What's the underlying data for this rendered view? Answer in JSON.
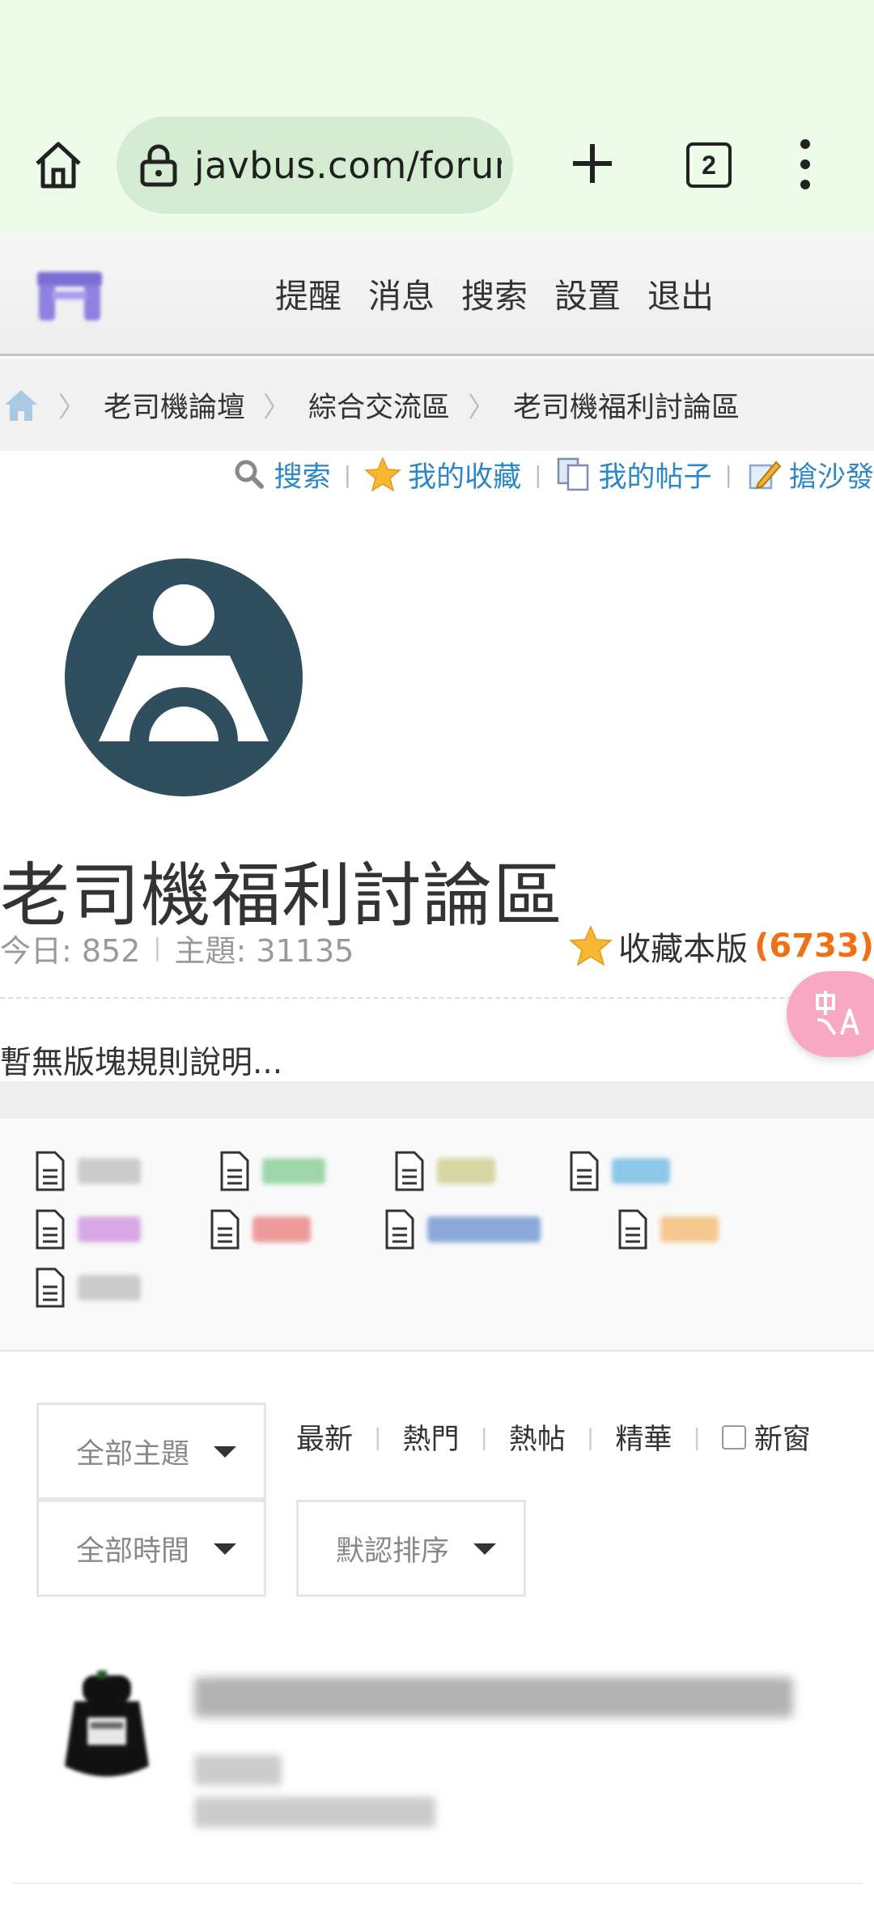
{
  "browser": {
    "url": "javbus.com/forum",
    "tab_count": "2",
    "icons": [
      "home-icon",
      "lock-icon",
      "new-tab-icon",
      "tabs-icon",
      "more-icon"
    ]
  },
  "header": {
    "nav": [
      "提醒",
      "消息",
      "搜索",
      "設置",
      "退出"
    ]
  },
  "breadcrumb": {
    "items": [
      "老司機論壇",
      "綜合交流區",
      "老司機福利討論區"
    ]
  },
  "quick_links": {
    "search": "搜索",
    "favorites": "我的收藏",
    "my_posts": "我的帖子",
    "sofa": "搶沙發"
  },
  "forum": {
    "title": "老司機福利討論區",
    "today_label": "今日: 852",
    "topics_label": "主題: 31135",
    "favorite_label": "收藏本版",
    "favorite_count": "(6733)",
    "rules": "暫無版塊規則說明..."
  },
  "type_tag_colors": [
    "#cccccc",
    "#9ed6a8",
    "#d6d6a0",
    "#8cc6e8",
    "#d8a8e6",
    "#ee9a9a",
    "#8aa8d8",
    "#f4c88e",
    "#cccccc"
  ],
  "filter": {
    "type_select": "全部主題",
    "time_select": "全部時間",
    "sort_select": "默認排序",
    "links": [
      "最新",
      "熱門",
      "熱帖",
      "精華"
    ],
    "new_window": "新窗"
  }
}
